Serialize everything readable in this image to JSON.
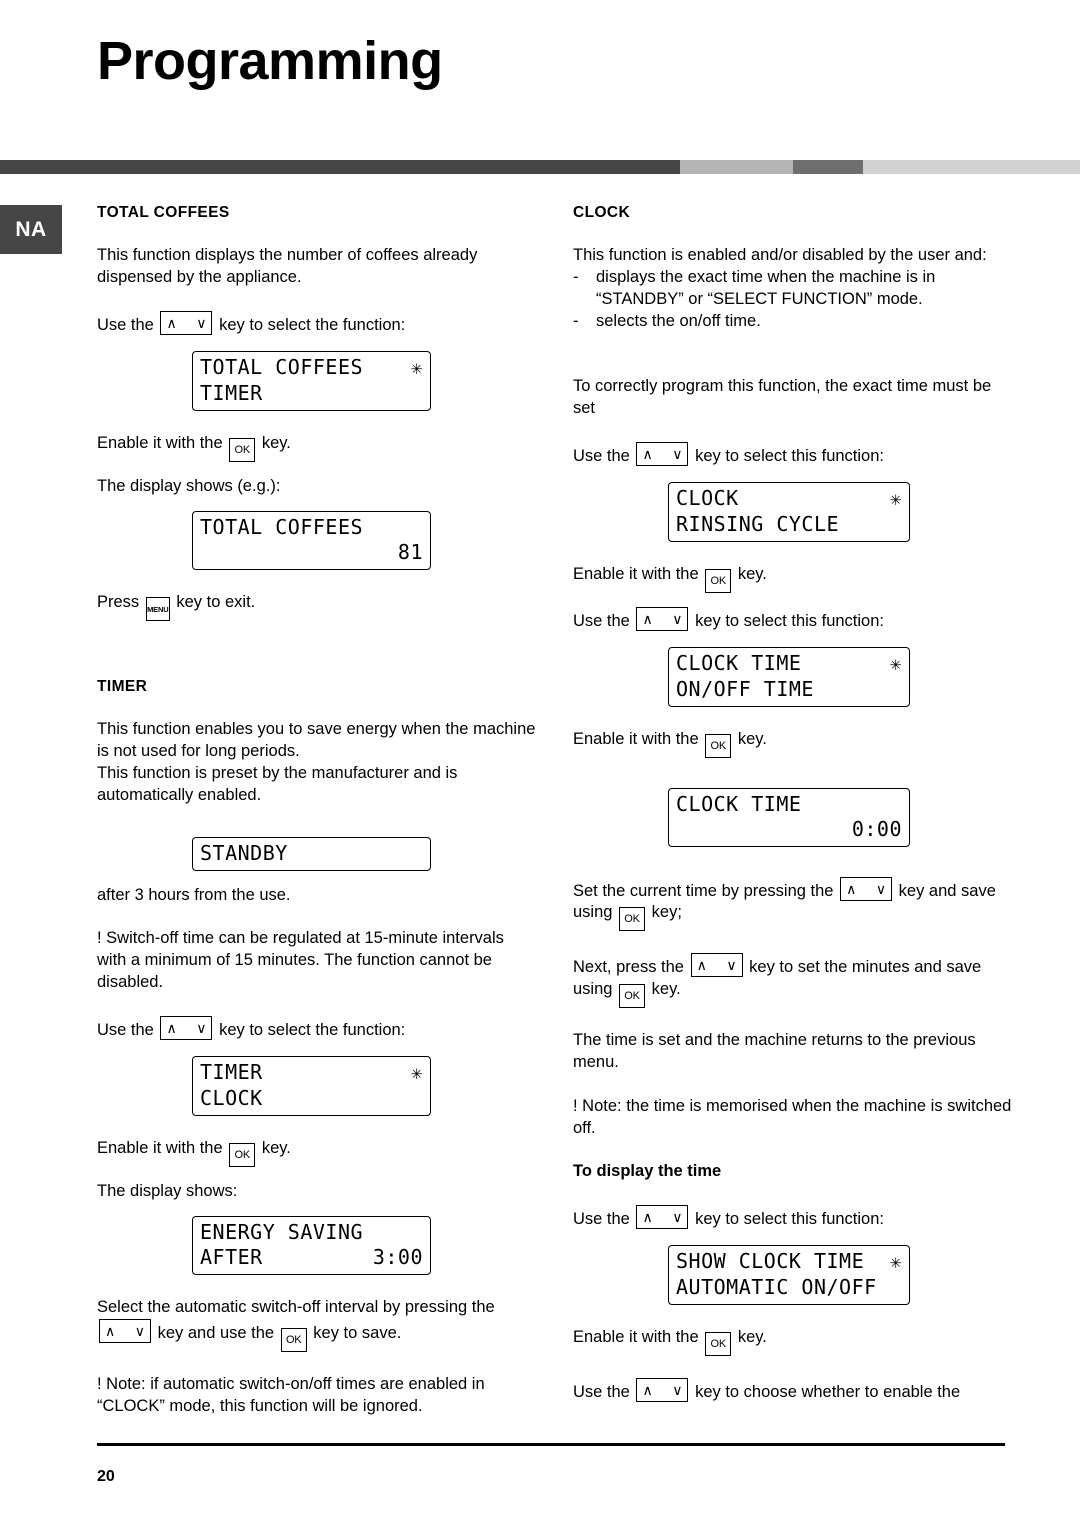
{
  "page": {
    "title": "Programming",
    "language_tab": "NA",
    "number": "20"
  },
  "header_bar": {
    "segments": [
      {
        "color": "#464646",
        "width_pct": 63.0
      },
      {
        "color": "#b4b4b4",
        "width_pct": 10.4
      },
      {
        "color": "#6e6e6e",
        "width_pct": 6.5
      },
      {
        "color": "#d2d2d2",
        "width_pct": 20.1
      }
    ]
  },
  "keys": {
    "arrow_up": "∧",
    "arrow_down": "∨",
    "ok": "OK",
    "menu": "MENU"
  },
  "left_column": {
    "total_coffees": {
      "heading": "TOTAL COFFEES",
      "intro": "This function displays the number of coffees already dispensed by the appliance.",
      "use_key_prefix": "Use the",
      "use_key_suffix": "key to select the function:",
      "lcd_select": {
        "line1_left": "TOTAL COFFEES",
        "line1_right": "✳",
        "line2_left": "TIMER",
        "line2_right": ""
      },
      "enable_prefix": "Enable it with the",
      "enable_suffix": "key.",
      "display_shows": "The display shows (e.g.):",
      "lcd_result": {
        "line1_left": "TOTAL COFFEES",
        "line1_right": "",
        "line2_left": "",
        "line2_right": "81"
      },
      "exit_prefix": "Press",
      "exit_suffix": "key to exit."
    },
    "timer": {
      "heading": "TIMER",
      "para1": "This function enables you to save energy when the machine is not used for long periods.",
      "para2": "This function is preset by the manufacturer and is automatically enabled.",
      "lcd_standby": {
        "line1_left": "",
        "line1_right": "",
        "line2_left": "STANDBY",
        "line2_right": ""
      },
      "after_text": "after 3 hours from the use.",
      "note1": "! Switch-off time can be regulated at 15-minute intervals with a minimum of 15 minutes. The function cannot be disabled.",
      "use_key_prefix": "Use the",
      "use_key_suffix": "key to select the function:",
      "lcd_select": {
        "line1_left": "TIMER",
        "line1_right": "✳",
        "line2_left": "CLOCK",
        "line2_right": ""
      },
      "enable_prefix": "Enable it with the",
      "enable_suffix": "key.",
      "display_shows": "The display shows:",
      "lcd_energy": {
        "line1_left": "ENERGY SAVING",
        "line1_right": "",
        "line2_left": "AFTER",
        "line2_right": "3:00"
      },
      "select_interval_part1": "Select the automatic switch-off interval by pressing the",
      "select_interval_part2": "key and use the",
      "select_interval_part3": "key to save.",
      "note2": "! Note: if automatic switch-on/off times are enabled in “CLOCK” mode, this function will be ignored."
    }
  },
  "right_column": {
    "clock": {
      "heading": "CLOCK",
      "intro": "This function is enabled and/or disabled by the user and:",
      "bullets": [
        "displays the exact time when the machine is in “STANDBY” or “SELECT FUNCTION” mode.",
        "selects the on/off time."
      ],
      "bullet_marker": "-",
      "program_note": "To correctly program this function, the exact time must be set",
      "use_key_prefix": "Use the",
      "use_key_suffix": "key to select this function:",
      "lcd_clock": {
        "line1_left": "CLOCK",
        "line1_right": "✳",
        "line2_left": "RINSING CYCLE",
        "line2_right": ""
      },
      "enable_prefix": "Enable it with the",
      "enable_suffix": "key.",
      "lcd_clock_time_sel": {
        "line1_left": "CLOCK TIME",
        "line1_right": "✳",
        "line2_left": "ON/OFF TIME",
        "line2_right": ""
      },
      "lcd_clock_time_val": {
        "line1_left": "CLOCK TIME",
        "line1_right": "",
        "line2_left": "",
        "line2_right": "0:00"
      },
      "set_time_part1": "Set the current time by pressing the",
      "set_time_part2": "key and save using",
      "set_time_part3": "key;",
      "set_minutes_part1": "Next, press the",
      "set_minutes_part2": "key to set the minutes and save using",
      "set_minutes_part3": "key.",
      "returns_text": "The time is set and the machine returns to the previous menu.",
      "memorised_note": "! Note: the time is memorised when the machine is switched off.",
      "display_time_heading": "To display the time",
      "display_time_use_prefix": "Use the",
      "display_time_use_suffix": "key to select this function:",
      "lcd_show_clock": {
        "line1_left": "SHOW CLOCK TIME",
        "line1_right": "✳",
        "line2_left": "AUTOMATIC ON/OFF",
        "line2_right": ""
      },
      "enable2_prefix": "Enable it with the",
      "enable2_suffix": "key.",
      "choose_prefix": "Use the",
      "choose_suffix": "key to choose whether to enable the"
    }
  }
}
